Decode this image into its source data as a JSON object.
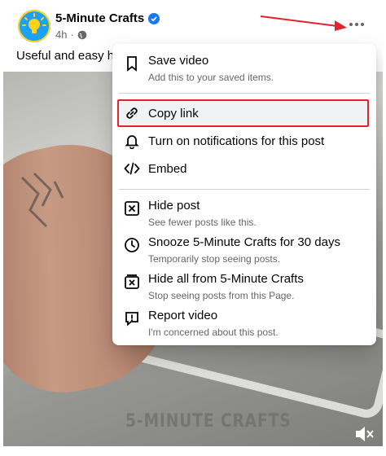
{
  "post": {
    "page_name": "5-Minute Crafts",
    "time": "4h",
    "caption": "Useful and easy h",
    "verified_icon": "verified-badge-icon",
    "privacy_icon": "globe-icon",
    "more_icon": "more-horizontal-icon"
  },
  "video": {
    "watermark": "5-MINUTE CRAFTS",
    "mute_icon": "speaker-muted-icon"
  },
  "menu": {
    "items": [
      {
        "label": "Save video",
        "sub": "Add this to your saved items.",
        "icon": "bookmark-icon"
      },
      {
        "label": "Copy link",
        "icon": "link-icon"
      },
      {
        "label": "Turn on notifications for this post",
        "icon": "bell-icon"
      },
      {
        "label": "Embed",
        "icon": "code-icon"
      },
      {
        "label": "Hide post",
        "sub": "See fewer posts like this.",
        "icon": "hide-x-icon"
      },
      {
        "label": "Snooze 5-Minute Crafts for 30 days",
        "sub": "Temporarily stop seeing posts.",
        "icon": "clock-icon"
      },
      {
        "label": "Hide all from 5-Minute Crafts",
        "sub": "Stop seeing posts from this Page.",
        "icon": "hide-all-icon"
      },
      {
        "label": "Report video",
        "sub": "I'm concerned about this post.",
        "icon": "report-icon"
      }
    ]
  },
  "colors": {
    "highlight_border": "#e0242b",
    "accent": "#1877f2",
    "secondary_text": "#65676b"
  }
}
